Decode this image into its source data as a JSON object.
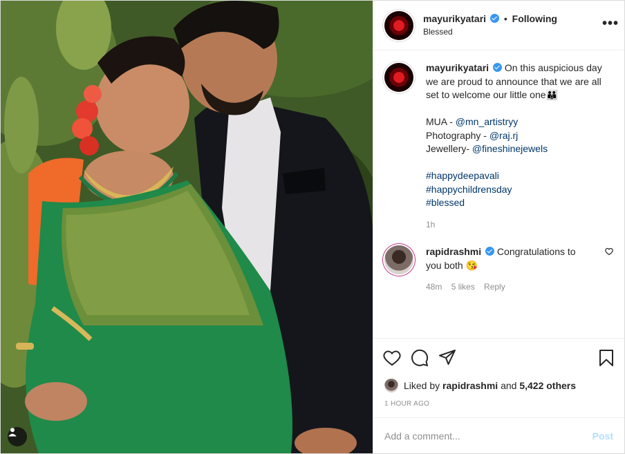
{
  "header": {
    "username": "mayurikyatari",
    "separator": "•",
    "follow_status": "Following",
    "location": "Blessed",
    "more": "•••"
  },
  "caption": {
    "username": "mayurikyatari",
    "text": "On this auspicious day we are proud to announce that we are all set to welcome our little one👪",
    "credits": [
      {
        "label": "MUA - ",
        "handle": "@mn_artistryy"
      },
      {
        "label": "Photography - ",
        "handle": "@raj.rj"
      },
      {
        "label": "Jewellery- ",
        "handle": "@fineshinejewels"
      }
    ],
    "hashtags": [
      "#happydeepavali",
      "#happychildrensday",
      "#blessed"
    ],
    "time": "1h"
  },
  "comment": {
    "username": "rapidrashmi",
    "text": "Congratulations to you both 😘",
    "time": "48m",
    "likes": "5 likes",
    "reply": "Reply"
  },
  "actions": {
    "icons": [
      "heart-icon",
      "comment-icon",
      "share-icon",
      "bookmark-icon"
    ]
  },
  "likes": {
    "prefix": "Liked by ",
    "user": "rapidrashmi",
    "suffix": " and ",
    "count": "5,422 others"
  },
  "posted": "1 HOUR AGO",
  "add_comment": {
    "placeholder": "Add a comment...",
    "post_label": "Post"
  },
  "colors": {
    "link": "#00376b",
    "verified": "#3897f0",
    "post_disabled": "#b2dffc",
    "muted": "#8e8e8e"
  }
}
